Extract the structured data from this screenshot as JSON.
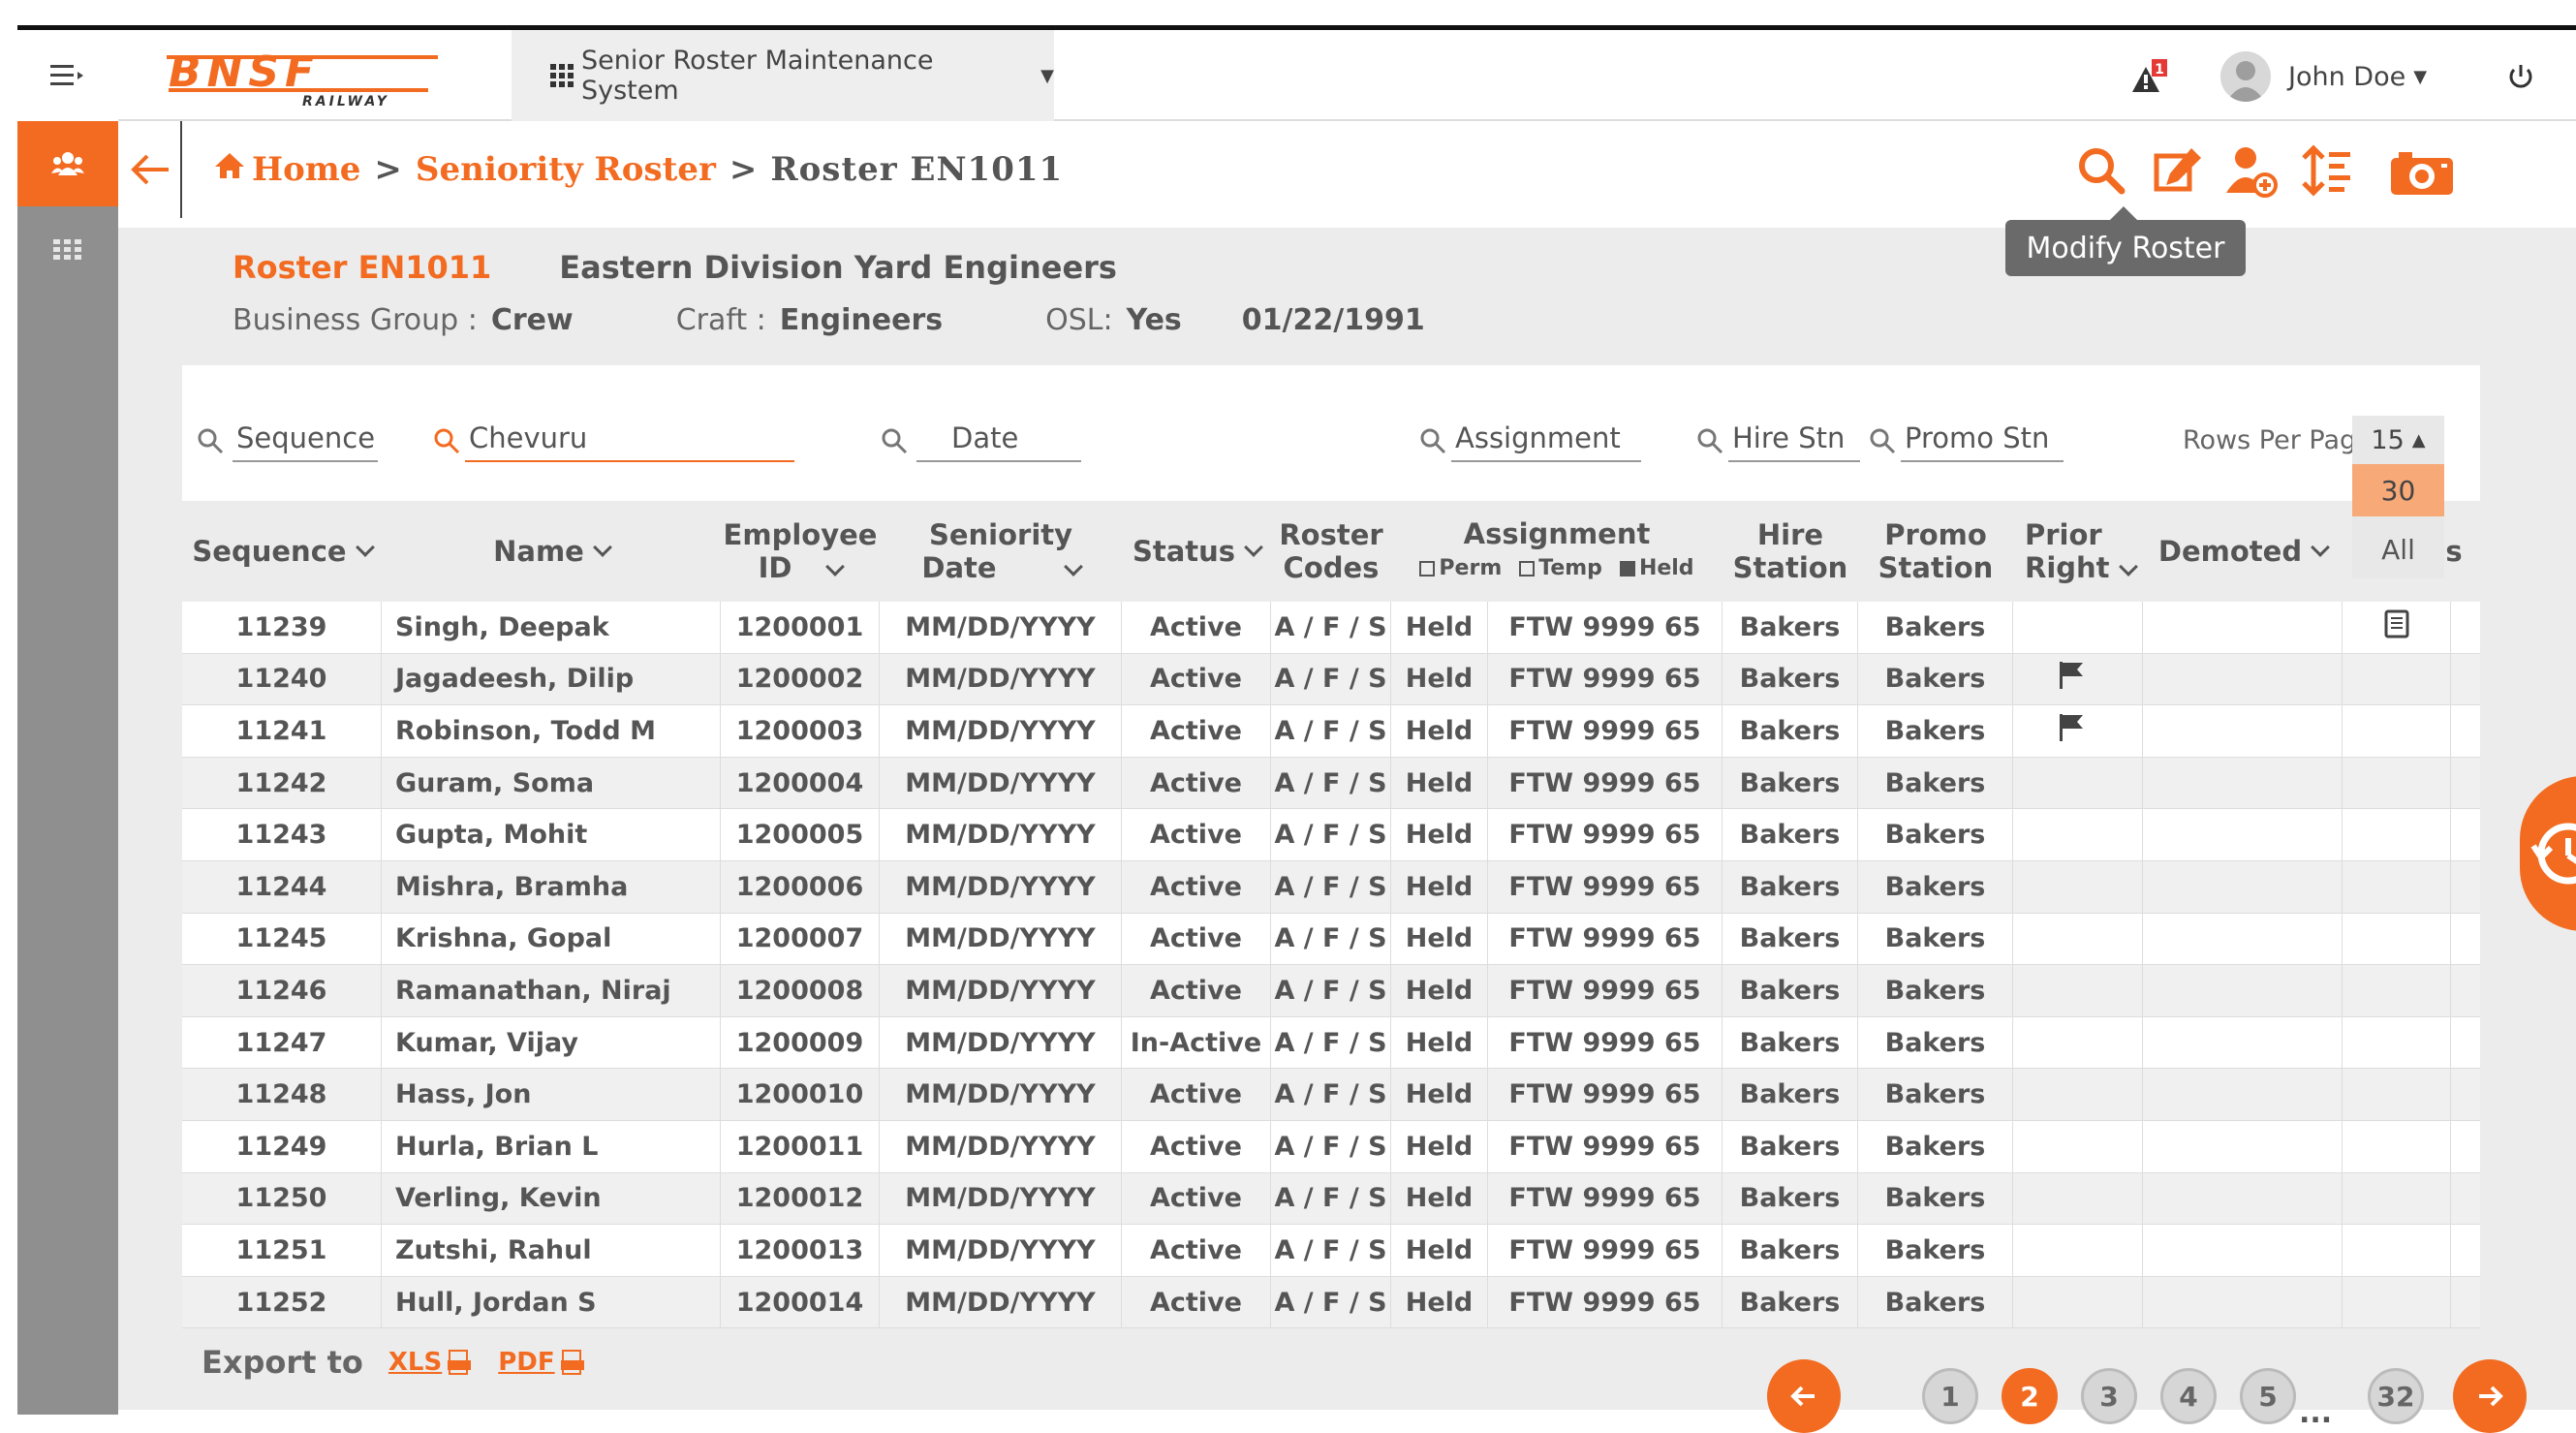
{
  "topbar": {
    "logo_text": "BNSF",
    "logo_sub": "RAILWAY",
    "app_name": "Senior Roster Maintenance System",
    "alert_count": "1",
    "user_name": "John Doe"
  },
  "breadcrumb": {
    "home": "Home",
    "sep1": ">",
    "section": "Seniority Roster",
    "sep2": ">",
    "current": "Roster EN1011"
  },
  "toolbar": {
    "tooltip": "Modify Roster",
    "icons": [
      "search-icon",
      "edit-icon",
      "add-user-icon",
      "sort-icon",
      "camera-icon"
    ]
  },
  "roster": {
    "id": "Roster EN1011",
    "description": "Eastern Division Yard Engineers",
    "business_group_label": "Business Group :",
    "business_group": "Crew",
    "craft_label": "Craft :",
    "craft": "Engineers",
    "osl_label": "OSL:",
    "osl": "Yes",
    "date": "01/22/1991"
  },
  "filters": {
    "sequence": "Sequence",
    "name": "Chevuru",
    "date": "Date",
    "assignment": "Assignment",
    "hire_stn": "Hire Stn",
    "promo_stn": "Promo Stn",
    "rows_per_page_label": "Rows Per Page",
    "rows_per_page": "15",
    "rows_options": [
      "30",
      "All"
    ]
  },
  "columns": {
    "sequence": "Sequence",
    "name": "Name",
    "employee_id_1": "Employee",
    "employee_id_2": "ID",
    "seniority_1": "Seniority",
    "seniority_2": "Date",
    "status": "Status",
    "roster_1": "Roster",
    "roster_2": "Codes",
    "assignment": "Assignment",
    "perm": "Perm",
    "temp": "Temp",
    "held": "Held",
    "hire_1": "Hire",
    "hire_2": "Station",
    "promo_1": "Promo",
    "promo_2": "Station",
    "prior_1": "Prior",
    "prior_2": "Right",
    "demoted": "Demoted",
    "last_partial": "s"
  },
  "rows": [
    {
      "seq": "11239",
      "name": "Singh, Deepak",
      "emp": "1200001",
      "date": "MM/DD/YYYY",
      "status": "Active",
      "codes": "A / F / S",
      "held": "Held",
      "assign": "FTW 9999 65",
      "hire": "Bakers",
      "promo": "Bakers",
      "prior_flag": false,
      "note_icon": true
    },
    {
      "seq": "11240",
      "name": "Jagadeesh, Dilip",
      "emp": "1200002",
      "date": "MM/DD/YYYY",
      "status": "Active",
      "codes": "A / F / S",
      "held": "Held",
      "assign": "FTW 9999 65",
      "hire": "Bakers",
      "promo": "Bakers",
      "prior_flag": true,
      "note_icon": false
    },
    {
      "seq": "11241",
      "name": "Robinson, Todd M",
      "emp": "1200003",
      "date": "MM/DD/YYYY",
      "status": "Active",
      "codes": "A / F / S",
      "held": "Held",
      "assign": "FTW 9999 65",
      "hire": "Bakers",
      "promo": "Bakers",
      "prior_flag": true,
      "note_icon": false
    },
    {
      "seq": "11242",
      "name": "Guram, Soma",
      "emp": "1200004",
      "date": "MM/DD/YYYY",
      "status": "Active",
      "codes": "A / F / S",
      "held": "Held",
      "assign": "FTW 9999 65",
      "hire": "Bakers",
      "promo": "Bakers",
      "prior_flag": false,
      "note_icon": false
    },
    {
      "seq": "11243",
      "name": "Gupta, Mohit",
      "emp": "1200005",
      "date": "MM/DD/YYYY",
      "status": "Active",
      "codes": "A / F / S",
      "held": "Held",
      "assign": "FTW 9999 65",
      "hire": "Bakers",
      "promo": "Bakers",
      "prior_flag": false,
      "note_icon": false
    },
    {
      "seq": "11244",
      "name": "Mishra, Bramha",
      "emp": "1200006",
      "date": "MM/DD/YYYY",
      "status": "Active",
      "codes": "A / F / S",
      "held": "Held",
      "assign": "FTW 9999 65",
      "hire": "Bakers",
      "promo": "Bakers",
      "prior_flag": false,
      "note_icon": false
    },
    {
      "seq": "11245",
      "name": "Krishna, Gopal",
      "emp": "1200007",
      "date": "MM/DD/YYYY",
      "status": "Active",
      "codes": "A / F / S",
      "held": "Held",
      "assign": "FTW 9999 65",
      "hire": "Bakers",
      "promo": "Bakers",
      "prior_flag": false,
      "note_icon": false
    },
    {
      "seq": "11246",
      "name": "Ramanathan, Niraj",
      "emp": "1200008",
      "date": "MM/DD/YYYY",
      "status": "Active",
      "codes": "A / F / S",
      "held": "Held",
      "assign": "FTW 9999 65",
      "hire": "Bakers",
      "promo": "Bakers",
      "prior_flag": false,
      "note_icon": false
    },
    {
      "seq": "11247",
      "name": "Kumar, Vijay",
      "emp": "1200009",
      "date": "MM/DD/YYYY",
      "status": "In-Active",
      "codes": "A / F / S",
      "held": "Held",
      "assign": "FTW 9999 65",
      "hire": "Bakers",
      "promo": "Bakers",
      "prior_flag": false,
      "note_icon": false
    },
    {
      "seq": "11248",
      "name": "Hass, Jon",
      "emp": "1200010",
      "date": "MM/DD/YYYY",
      "status": "Active",
      "codes": "A / F / S",
      "held": "Held",
      "assign": "FTW 9999 65",
      "hire": "Bakers",
      "promo": "Bakers",
      "prior_flag": false,
      "note_icon": false
    },
    {
      "seq": "11249",
      "name": "Hurla, Brian L",
      "emp": "1200011",
      "date": "MM/DD/YYYY",
      "status": "Active",
      "codes": "A / F / S",
      "held": "Held",
      "assign": "FTW 9999 65",
      "hire": "Bakers",
      "promo": "Bakers",
      "prior_flag": false,
      "note_icon": false
    },
    {
      "seq": "11250",
      "name": "Verling, Kevin",
      "emp": "1200012",
      "date": "MM/DD/YYYY",
      "status": "Active",
      "codes": "A / F / S",
      "held": "Held",
      "assign": "FTW 9999 65",
      "hire": "Bakers",
      "promo": "Bakers",
      "prior_flag": false,
      "note_icon": false
    },
    {
      "seq": "11251",
      "name": "Zutshi, Rahul",
      "emp": "1200013",
      "date": "MM/DD/YYYY",
      "status": "Active",
      "codes": "A / F / S",
      "held": "Held",
      "assign": "FTW 9999 65",
      "hire": "Bakers",
      "promo": "Bakers",
      "prior_flag": false,
      "note_icon": false
    },
    {
      "seq": "11252",
      "name": "Hull, Jordan S",
      "emp": "1200014",
      "date": "MM/DD/YYYY",
      "status": "Active",
      "codes": "A / F / S",
      "held": "Held",
      "assign": "FTW 9999 65",
      "hire": "Bakers",
      "promo": "Bakers",
      "prior_flag": false,
      "note_icon": false
    }
  ],
  "footer": {
    "export_label": "Export to",
    "xls": "XLS",
    "pdf": "PDF",
    "pages": [
      "1",
      "2",
      "3",
      "4",
      "5"
    ],
    "current_page": "2",
    "ellipsis": "...",
    "last_page": "32"
  },
  "colors": {
    "accent": "#f26b21",
    "rail": "#8f8f8f"
  }
}
